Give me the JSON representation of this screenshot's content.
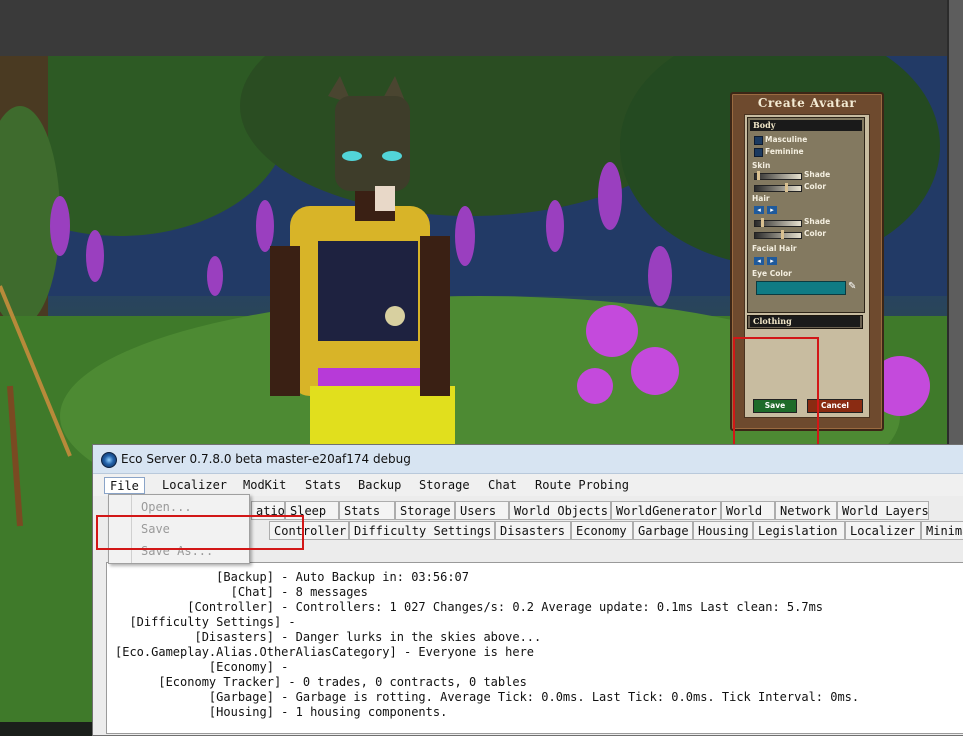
{
  "game": {
    "avatar_panel": {
      "title": "Create Avatar",
      "body_header": "Body",
      "masculine": "Masculine",
      "feminine": "Feminine",
      "skin": "Skin",
      "hair": "Hair",
      "shade": "Shade",
      "color": "Color",
      "facial_hair": "Facial Hair",
      "eye_color": "Eye Color",
      "clothing_header": "Clothing",
      "save": "Save",
      "cancel": "Cancel",
      "eye_color_value": "#0f7b84"
    }
  },
  "server_window": {
    "title": "Eco Server 0.7.8.0 beta master-e20af174 debug",
    "menu": [
      "File",
      "Localizer",
      "ModKit",
      "Stats",
      "Backup",
      "Storage",
      "Chat",
      "Route Probing"
    ],
    "file_menu": [
      "Open...",
      "Save",
      "Save As..."
    ],
    "tabs_row1": [
      "ation",
      "Sleep",
      "Stats",
      "Storage",
      "Users",
      "World Objects",
      "WorldGenerator",
      "World",
      "Network",
      "World Layers"
    ],
    "tabs_row2": [
      "Controller",
      "Difficulty Settings",
      "Disasters",
      "Economy",
      "Garbage",
      "Housing",
      "Legislation",
      "Localizer",
      "Minima"
    ],
    "log": [
      "              [Backup] - Auto Backup in: 03:56:07",
      "                [Chat] - 8 messages",
      "          [Controller] - Controllers: 1 027 Changes/s: 0.2 Average update: 0.1ms Last clean: 5.7ms",
      "  [Difficulty Settings] -",
      "           [Disasters] - Danger lurks in the skies above...",
      "[Eco.Gameplay.Alias.OtherAliasCategory] - Everyone is here",
      "             [Economy] -",
      "      [Economy Tracker] - 0 trades, 0 contracts, 0 tables",
      "             [Garbage] - Garbage is rotting. Average Tick: 0.0ms. Last Tick: 0.0ms. Tick Interval: 0ms.",
      "             [Housing] - 1 housing components."
    ]
  },
  "colors": {
    "highlight": "#d21717",
    "save_button": "#1e6b2a",
    "cancel_button": "#8a2b12"
  }
}
